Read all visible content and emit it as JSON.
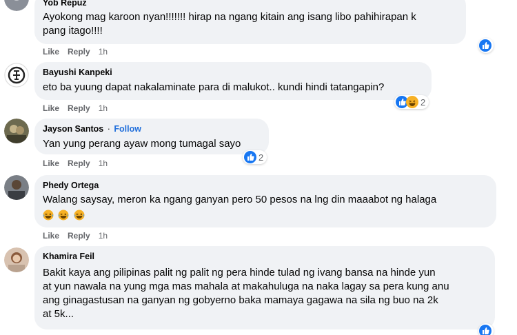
{
  "comments": [
    {
      "author": "Yob Repuz",
      "text_lines": [
        "Ayokong mag karoon nyan!!!!!!! hirap na ngang kitain ang isang libo pahihirapan k",
        "pang itago!!!!"
      ],
      "actions": {
        "like": "Like",
        "reply": "Reply",
        "time": "1h"
      }
    },
    {
      "author": "Bayushi Kanpeki",
      "text_lines": [
        "eto ba yuung dapat nakalaminate para di malukot.. kundi hindi tatangapin?"
      ],
      "actions": {
        "like": "Like",
        "reply": "Reply",
        "time": "1h"
      },
      "reaction_count": "2"
    },
    {
      "author": "Jayson Santos",
      "follow": "Follow",
      "separator": "·",
      "text_lines": [
        "Yan yung perang ayaw mong tumagal sayo"
      ],
      "actions": {
        "like": "Like",
        "reply": "Reply",
        "time": "1h"
      },
      "reaction_count": "2"
    },
    {
      "author": "Phedy Ortega",
      "text_lines": [
        "Walang saysay, meron ka ngang ganyan pero 50 pesos na lng din maaabot ng halaga"
      ],
      "actions": {
        "like": "Like",
        "reply": "Reply",
        "time": "1h"
      }
    },
    {
      "author": "Khamira Feil",
      "text_lines": [
        "Bakit kaya ang pilipinas palit ng palit ng pera hinde tulad ng ivang bansa na hinde yun",
        "at yun nawala na yung mga mas mahala at makahuluga na naka lagay sa pera kung anu",
        "ang ginagastusan na ganyan ng gobyerno baka mamaya gagawa na sila ng buo na 2k",
        "at 5k..."
      ]
    }
  ],
  "colors": {
    "bubble": "#f0f2f5",
    "like_blue": "#1877f2",
    "follow_blue": "#216fdb",
    "meta_gray": "#65676b"
  }
}
